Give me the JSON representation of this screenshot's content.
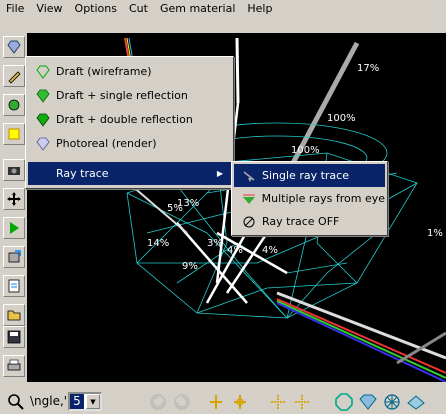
{
  "menubar": {
    "items": [
      "File",
      "View",
      "Options",
      "Cut",
      "Gem material",
      "Help"
    ]
  },
  "view_menu": {
    "items": [
      {
        "label": "Draft (wireframe)",
        "icon": "gem-wire-icon"
      },
      {
        "label": "Draft + single reflection",
        "icon": "gem-green-icon"
      },
      {
        "label": "Draft + double reflection",
        "icon": "gem-green-icon"
      },
      {
        "label": "Photoreal (render)",
        "icon": "gem-render-icon"
      },
      {
        "label": "Ray trace",
        "icon": "none",
        "submenu_arrow": "▶",
        "selected": true
      }
    ]
  },
  "raytrace_submenu": {
    "items": [
      {
        "label": "Single ray trace",
        "icon": "single-ray-icon",
        "selected": true
      },
      {
        "label": "Multiple rays from eye",
        "icon": "multi-ray-icon"
      },
      {
        "label": "Ray trace OFF",
        "icon": "ray-off-icon"
      }
    ]
  },
  "viewport": {
    "percent_labels": [
      "17%",
      "100%",
      "100%",
      "1%",
      "13%",
      "5%",
      "14%",
      "3%",
      "4%",
      "4%",
      "9%"
    ]
  },
  "bottombar": {
    "angle_label": "\\ngle,'",
    "angle_value": "5",
    "dropdown_arrow": "▼"
  }
}
